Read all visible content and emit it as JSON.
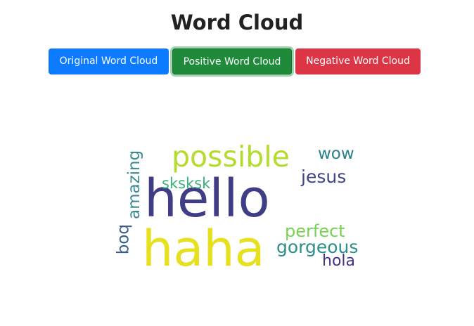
{
  "page": {
    "title": "Word Cloud"
  },
  "buttons": {
    "original_label": "Original Word Cloud",
    "positive_label": "Positive Word Cloud",
    "negative_label": "Negative Word Cloud"
  },
  "colors": {
    "original_button": "#0d7bff",
    "positive_button": "#1f8a3a",
    "negative_button": "#dc3545"
  },
  "word_cloud": {
    "words": [
      {
        "text": "hello",
        "color": "#3f3d86"
      },
      {
        "text": "haha",
        "color": "#e6e01f"
      },
      {
        "text": "possible",
        "color": "#b3dc2c"
      },
      {
        "text": "wow",
        "color": "#2b7f8c"
      },
      {
        "text": "jesus",
        "color": "#3f4486"
      },
      {
        "text": "sksksk",
        "color": "#3bb27a"
      },
      {
        "text": "amazing",
        "color": "#3b8a8f"
      },
      {
        "text": "boq",
        "color": "#3a5e8c"
      },
      {
        "text": "perfect",
        "color": "#78d152"
      },
      {
        "text": "gorgeous",
        "color": "#2a8f8a"
      },
      {
        "text": "hola",
        "color": "#46327e"
      }
    ]
  }
}
